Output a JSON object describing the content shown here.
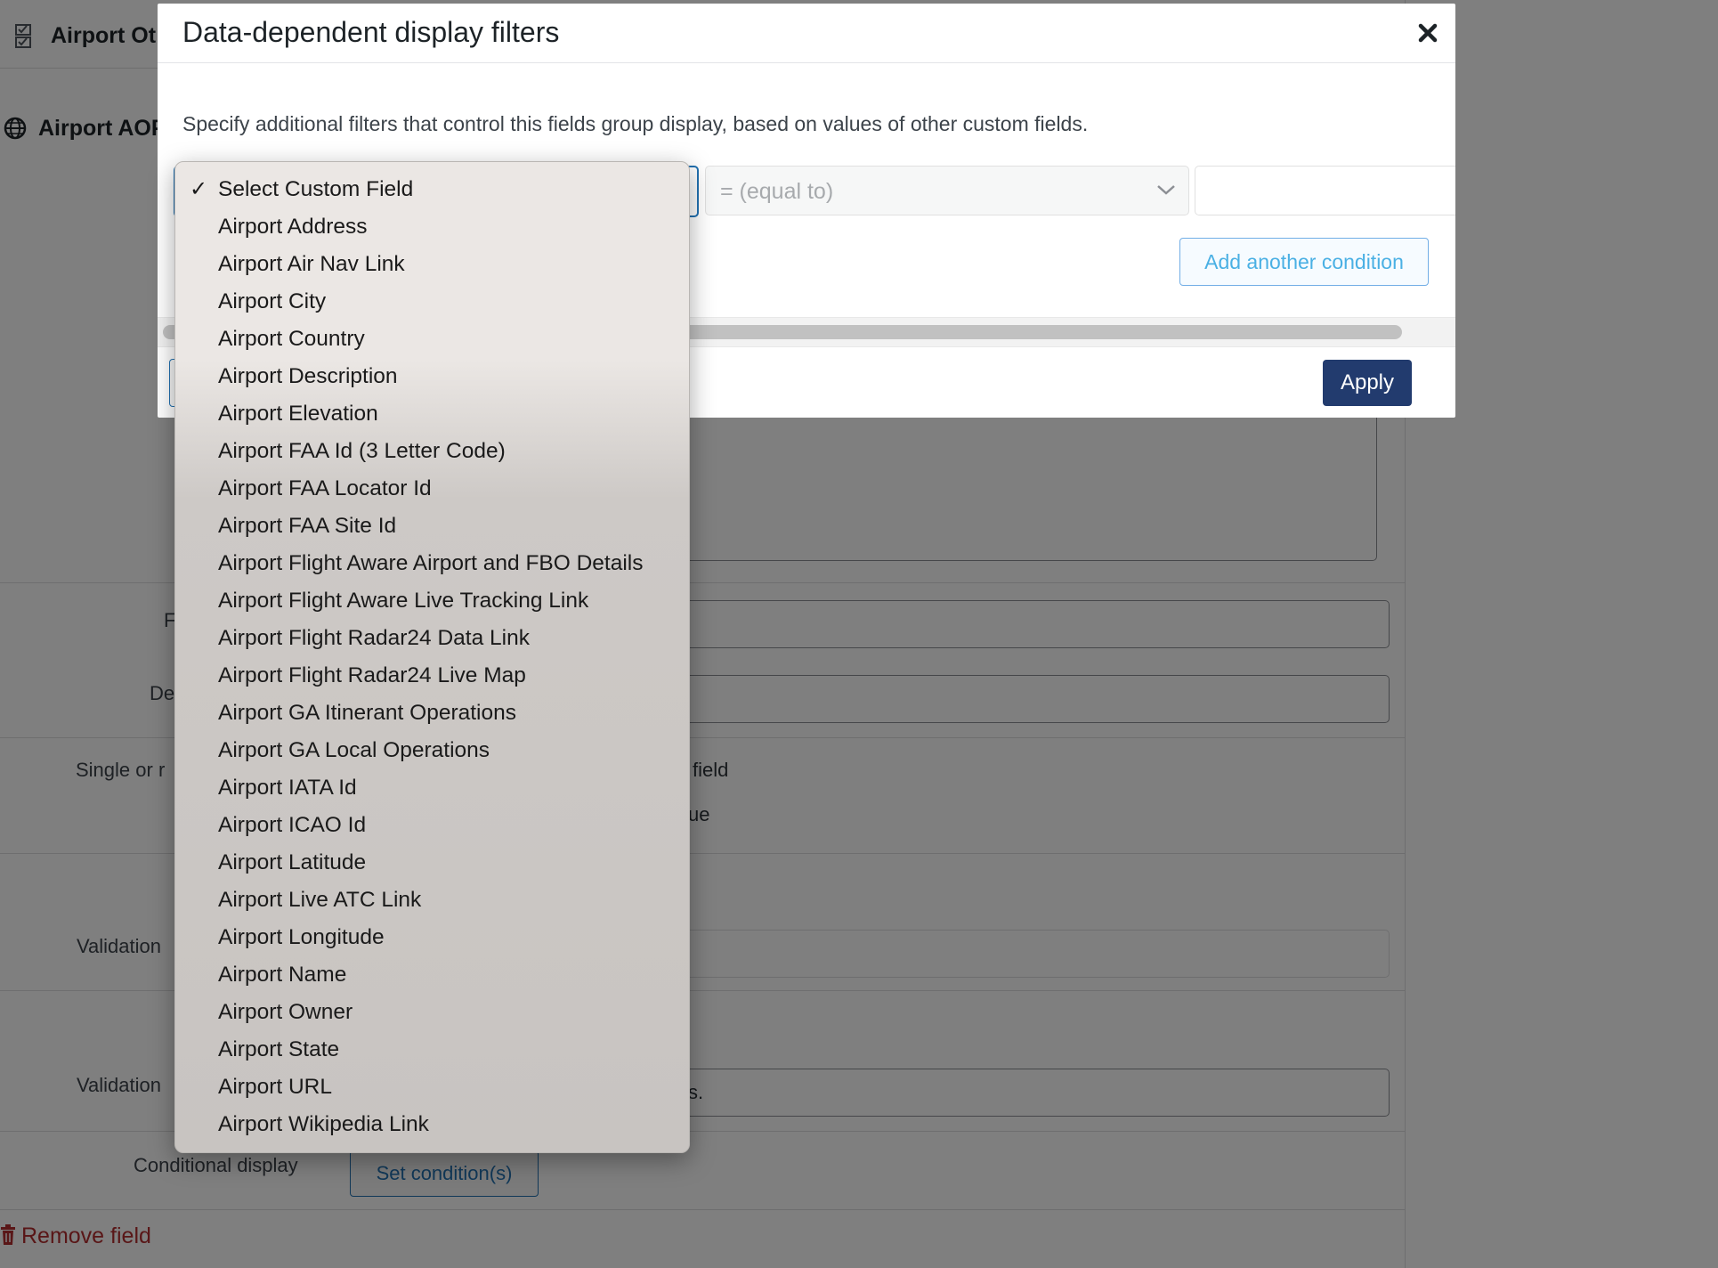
{
  "background": {
    "groups": [
      {
        "label": "Airport Ot",
        "icon": "checklist-icon"
      },
      {
        "label": "Airport AOP",
        "icon": "globe-icon"
      }
    ],
    "labels": {
      "row1": "F",
      "row2": "De",
      "single_or": "Single or r",
      "validation1": "Validation",
      "validation2": "Validation",
      "conditional_display": "Conditional display"
    },
    "texts": {
      "field_fragment": "field",
      "ue_fragment": "ue",
      "s_fragment": "s."
    },
    "set_conditions_label": "Set condition(s)",
    "remove_field_label": "Remove field"
  },
  "modal": {
    "title": "Data-dependent display filters",
    "close_icon": "close-icon",
    "description": "Specify additional filters that control this fields group display, based on values of other custom fields.",
    "operator": {
      "selected": "= (equal to)"
    },
    "value": {
      "current": ""
    },
    "add_condition_label": "Add another condition",
    "apply_label": "Apply"
  },
  "dropdown": {
    "selected_index": 0,
    "check_glyph": "✓",
    "options": [
      "Select Custom Field",
      "Airport Address",
      "Airport Air Nav Link",
      "Airport City",
      "Airport Country",
      "Airport Description",
      "Airport Elevation",
      "Airport FAA Id (3 Letter Code)",
      "Airport FAA Locator Id",
      "Airport FAA Site Id",
      "Airport Flight Aware Airport and FBO Details",
      "Airport Flight Aware Live Tracking Link",
      "Airport Flight Radar24 Data Link",
      "Airport Flight Radar24 Live Map",
      "Airport GA Itinerant Operations",
      "Airport GA Local Operations",
      "Airport IATA Id",
      "Airport ICAO Id",
      "Airport Latitude",
      "Airport Live ATC Link",
      "Airport Longitude",
      "Airport Name",
      "Airport Owner",
      "Airport State",
      "Airport URL",
      "Airport Wikipedia Link"
    ]
  }
}
